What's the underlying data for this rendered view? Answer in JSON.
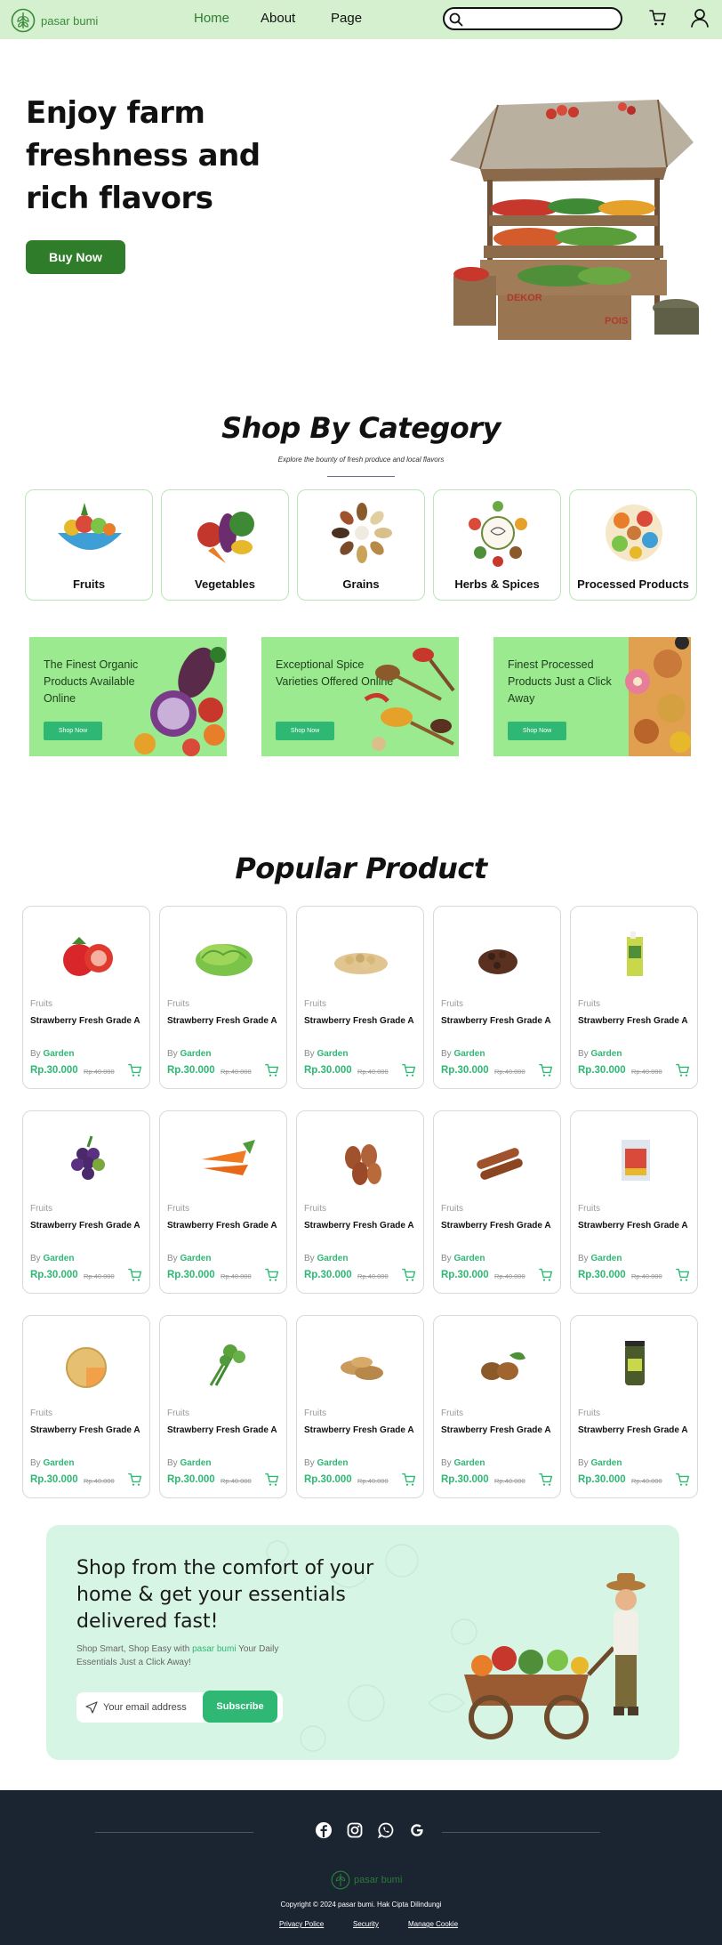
{
  "brand": {
    "name": "pasar bumi"
  },
  "nav": {
    "links": [
      "Home",
      "About",
      "Page"
    ],
    "active": "Home",
    "search_placeholder": ""
  },
  "hero": {
    "title": "Enjoy farm freshness and rich flavors",
    "button": "Buy Now"
  },
  "category": {
    "title": "Shop By Category",
    "subtitle": "Explore the bounty of fresh produce and local flavors",
    "items": [
      {
        "label": "Fruits",
        "icon": "fruit-bowl-icon"
      },
      {
        "label": "Vegetables",
        "icon": "vegetables-icon"
      },
      {
        "label": "Grains",
        "icon": "grains-icon"
      },
      {
        "label": "Herbs & Spices",
        "icon": "herbs-spices-icon"
      },
      {
        "label": "Processed Products",
        "icon": "processed-products-icon"
      }
    ]
  },
  "promos": [
    {
      "text": "The Finest Organic Products Available Online",
      "button": "Shop Now"
    },
    {
      "text": "Exceptional Spice Varieties Offered Online",
      "button": "Shop Now"
    },
    {
      "text": "Finest Processed Products Just a Click Away",
      "button": "Shop Now"
    }
  ],
  "popular": {
    "title": "Popular Product",
    "by_prefix": "By",
    "products": [
      {
        "category": "Fruits",
        "name": "Strawberry Fresh Grade A",
        "seller": "Garden",
        "price": "Rp.30.000",
        "old_price": "Rp.40.000",
        "image": "strawberry"
      },
      {
        "category": "Fruits",
        "name": "Strawberry Fresh Grade A",
        "seller": "Garden",
        "price": "Rp.30.000",
        "old_price": "Rp.40.000",
        "image": "lettuce"
      },
      {
        "category": "Fruits",
        "name": "Strawberry Fresh Grade A",
        "seller": "Garden",
        "price": "Rp.30.000",
        "old_price": "Rp.40.000",
        "image": "soybeans"
      },
      {
        "category": "Fruits",
        "name": "Strawberry Fresh Grade A",
        "seller": "Garden",
        "price": "Rp.30.000",
        "old_price": "Rp.40.000",
        "image": "cloves"
      },
      {
        "category": "Fruits",
        "name": "Strawberry Fresh Grade A",
        "seller": "Garden",
        "price": "Rp.30.000",
        "old_price": "Rp.40.000",
        "image": "juice-box"
      },
      {
        "category": "Fruits",
        "name": "Strawberry Fresh Grade A",
        "seller": "Garden",
        "price": "Rp.30.000",
        "old_price": "Rp.40.000",
        "image": "grapes"
      },
      {
        "category": "Fruits",
        "name": "Strawberry Fresh Grade A",
        "seller": "Garden",
        "price": "Rp.30.000",
        "old_price": "Rp.40.000",
        "image": "carrots"
      },
      {
        "category": "Fruits",
        "name": "Strawberry Fresh Grade A",
        "seller": "Garden",
        "price": "Rp.30.000",
        "old_price": "Rp.40.000",
        "image": "almonds"
      },
      {
        "category": "Fruits",
        "name": "Strawberry Fresh Grade A",
        "seller": "Garden",
        "price": "Rp.30.000",
        "old_price": "Rp.40.000",
        "image": "cinnamon"
      },
      {
        "category": "Fruits",
        "name": "Strawberry Fresh Grade A",
        "seller": "Garden",
        "price": "Rp.30.000",
        "old_price": "Rp.40.000",
        "image": "snack-pack"
      },
      {
        "category": "Fruits",
        "name": "Strawberry Fresh Grade A",
        "seller": "Garden",
        "price": "Rp.30.000",
        "old_price": "Rp.40.000",
        "image": "melon"
      },
      {
        "category": "Fruits",
        "name": "Strawberry Fresh Grade A",
        "seller": "Garden",
        "price": "Rp.30.000",
        "old_price": "Rp.40.000",
        "image": "herbs"
      },
      {
        "category": "Fruits",
        "name": "Strawberry Fresh Grade A",
        "seller": "Garden",
        "price": "Rp.30.000",
        "old_price": "Rp.40.000",
        "image": "peanuts"
      },
      {
        "category": "Fruits",
        "name": "Strawberry Fresh Grade A",
        "seller": "Garden",
        "price": "Rp.30.000",
        "old_price": "Rp.40.000",
        "image": "nutmeg"
      },
      {
        "category": "Fruits",
        "name": "Strawberry Fresh Grade A",
        "seller": "Garden",
        "price": "Rp.30.000",
        "old_price": "Rp.40.000",
        "image": "jar"
      }
    ]
  },
  "newsletter": {
    "title": "Shop from the comfort of your home & get your essentials delivered fast!",
    "sub_prefix": "Shop Smart, Shop Easy with",
    "sub_brand": "pasar bumi",
    "sub_suffix": "Your Daily Essentials Just a Click Away!",
    "email_placeholder": "Your email address",
    "button": "Subscribe"
  },
  "footer": {
    "social": [
      "facebook-icon",
      "instagram-icon",
      "whatsapp-icon",
      "google-icon"
    ],
    "copyright": "Copyright © 2024 pasar bumi. Hak Cipta Dilindungi",
    "links": [
      "Privacy Police",
      "Security",
      "Manage Cookie"
    ]
  },
  "colors": {
    "nav_bg": "#d4f0cf",
    "primary_green": "#2f7d2a",
    "accent_green": "#2fb774",
    "promo_bg": "#9bea8f",
    "newsletter_bg": "#d7f5e5",
    "footer_bg": "#1b2431"
  }
}
